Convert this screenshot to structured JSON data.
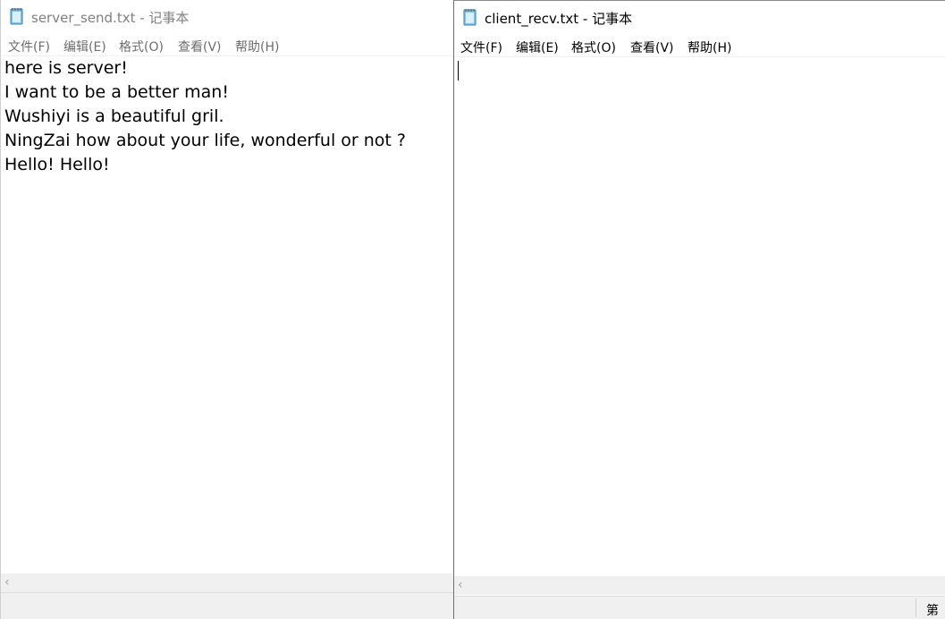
{
  "left_window": {
    "title": "server_send.txt - 记事本",
    "menu": [
      "文件(F)",
      "编辑(E)",
      "格式(O)",
      "查看(V)",
      "帮助(H)"
    ],
    "lines": [
      "here is server!",
      "I want to be a better man!",
      "Wushiyi is a beautiful gril.",
      "NingZai how about your life, wonderful or not ?",
      "Hello! Hello!"
    ]
  },
  "right_window": {
    "title": "client_recv.txt - 记事本",
    "menu": [
      "文件(F)",
      "编辑(E)",
      "格式(O)",
      "查看(V)",
      "帮助(H)"
    ],
    "lines": [],
    "status_text": "第"
  },
  "icons": {
    "notepad": "notepad-icon",
    "scroll_left": "scroll-left-arrow-icon"
  }
}
